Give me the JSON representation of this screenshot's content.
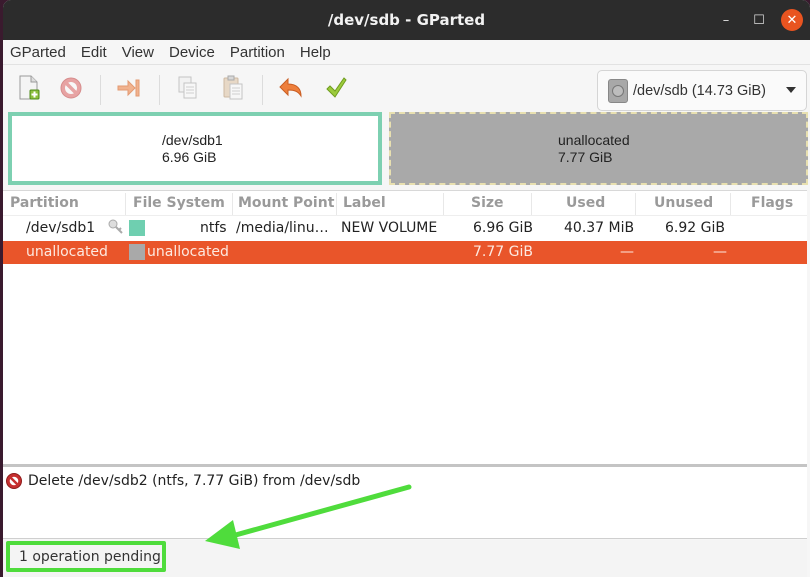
{
  "window": {
    "title": "/dev/sdb - GParted",
    "controls": {
      "minimize": "–",
      "maximize": "☐",
      "close": "✕"
    }
  },
  "menubar": [
    "GParted",
    "Edit",
    "View",
    "Device",
    "Partition",
    "Help"
  ],
  "toolbar": {
    "buttons": [
      {
        "name": "new",
        "icon": "new-partition-icon"
      },
      {
        "name": "delete",
        "icon": "delete-icon"
      },
      {
        "name": "resize-move",
        "icon": "resize-move-icon"
      },
      {
        "name": "copy",
        "icon": "copy-icon"
      },
      {
        "name": "paste",
        "icon": "paste-icon"
      },
      {
        "name": "undo",
        "icon": "undo-icon"
      },
      {
        "name": "apply",
        "icon": "apply-icon"
      }
    ],
    "device_selector": "/dev/sdb (14.73 GiB)"
  },
  "disk_map": [
    {
      "name": "/dev/sdb1",
      "size": "6.96 GiB",
      "color": "#7dd0b1"
    },
    {
      "name": "unallocated",
      "size": "7.77 GiB",
      "color": "#a9a9a9"
    }
  ],
  "table": {
    "columns": [
      "Partition",
      "File System",
      "Mount Point",
      "Label",
      "Size",
      "Used",
      "Unused",
      "Flags"
    ],
    "rows": [
      {
        "partition": "/dev/sdb1",
        "mounted": true,
        "fs_color": "#6fcfb0",
        "filesystem": "ntfs",
        "mount_point": "/media/linu…",
        "label": "NEW VOLUME",
        "size": "6.96 GiB",
        "used": "40.37 MiB",
        "unused": "6.92 GiB",
        "flags": "",
        "selected": false
      },
      {
        "partition": "unallocated",
        "mounted": false,
        "fs_color": "#a9a9a9",
        "filesystem": "unallocated",
        "mount_point": "",
        "label": "",
        "size": "7.77 GiB",
        "used": "—",
        "unused": "—",
        "flags": "",
        "selected": true
      }
    ]
  },
  "operations": [
    {
      "icon": "delete-icon",
      "text": "Delete /dev/sdb2 (ntfs, 7.77 GiB) from /dev/sdb"
    }
  ],
  "status": "1 operation pending",
  "colors": {
    "selection": "#e9552a",
    "annotation": "#4fdc3c",
    "close_button": "#e95420"
  }
}
